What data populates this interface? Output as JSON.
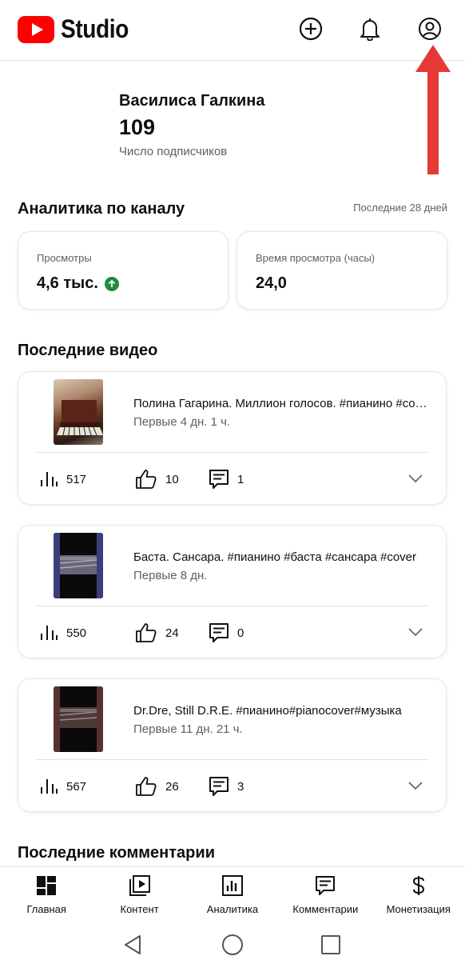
{
  "header": {
    "logo_text": "Studio",
    "icons": [
      "create-icon",
      "notifications-icon",
      "account-icon"
    ]
  },
  "channel": {
    "name": "Василиса Галкина",
    "subscribers": "109",
    "subscribers_label": "Число подписчиков"
  },
  "analytics": {
    "title": "Аналитика по каналу",
    "period": "Последние 28 дней",
    "views_label": "Просмотры",
    "views_value": "4,6 тыс.",
    "watch_label": "Время просмотра (часы)",
    "watch_value": "24,0",
    "trend_color": "#1e8e3e"
  },
  "recent_videos": {
    "title": "Последние видео",
    "items": [
      {
        "title": "Полина Гагарина. Миллион голосов. #пианино #cover",
        "period": "Первые 4 дн. 1 ч.",
        "views": "517",
        "likes": "10",
        "comments": "1"
      },
      {
        "title": "Баста. Сансара. #пианино #баста #сансара #cover",
        "period": "Первые 8 дн.",
        "views": "550",
        "likes": "24",
        "comments": "0"
      },
      {
        "title": "Dr.Dre, Still D.R.E. #пианино#pianocover#музыка",
        "period": "Первые 11 дн. 21 ч.",
        "views": "567",
        "likes": "26",
        "comments": "3"
      }
    ]
  },
  "recent_comments": {
    "title": "Последние комментарии"
  },
  "bottom_nav": [
    {
      "label": "Главная",
      "icon": "dashboard-icon"
    },
    {
      "label": "Контент",
      "icon": "content-icon"
    },
    {
      "label": "Аналитика",
      "icon": "analytics-icon"
    },
    {
      "label": "Комментарии",
      "icon": "comments-icon"
    },
    {
      "label": "Монетизация",
      "icon": "monetization-icon"
    }
  ],
  "colors": {
    "brand": "#ff0000",
    "annotation_arrow": "#e53935"
  }
}
